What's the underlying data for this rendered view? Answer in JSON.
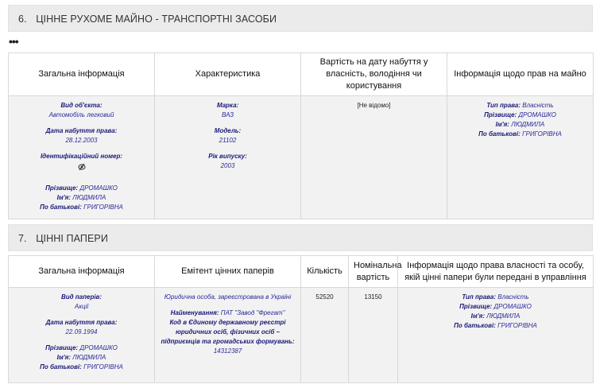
{
  "section6": {
    "number": "6.",
    "title": "ЦІННЕ РУХОМЕ МАЙНО - ТРАНСПОРТНІ ЗАСОБИ",
    "more": "•••",
    "headers": [
      "Загальна інформація",
      "Характеристика",
      "Вартість на дату набуття у власність, володіння чи користування",
      "Інформація щодо прав на майно"
    ],
    "general": {
      "type_label": "Вид об'єкта:",
      "type_value": "Автомобіль легковий",
      "date_label": "Дата набуття права:",
      "date_value": "28.12.2003",
      "id_label": "Ідентифікаційний номер:",
      "id_icon": "hidden-icon",
      "surname_label": "Прізвище:",
      "surname_value": "ДРОМАШКО",
      "name_label": "Ім'я:",
      "name_value": "ЛЮДМИЛА",
      "patronymic_label": "По батькові:",
      "patronymic_value": "ГРИГОРІВНА"
    },
    "specs": {
      "brand_label": "Марка:",
      "brand_value": "ВАЗ",
      "model_label": "Модель:",
      "model_value": "21102",
      "year_label": "Рік випуску:",
      "year_value": "2003"
    },
    "cost": "[Не відомо]",
    "rights": {
      "type_label": "Тип права:",
      "type_value": "Власність",
      "surname_label": "Прізвище:",
      "surname_value": "ДРОМАШКО",
      "name_label": "Ім'я:",
      "name_value": "ЛЮДМИЛА",
      "patronymic_label": "По батькові:",
      "patronymic_value": "ГРИГОРІВНА"
    }
  },
  "section7": {
    "number": "7.",
    "title": "ЦІННІ ПАПЕРИ",
    "headers": [
      "Загальна інформація",
      "Емітент цінних паперів",
      "Кількість",
      "Номінальна вартість",
      "Інформація щодо права власності та особу, якій цінні папери були передані в управління"
    ],
    "general": {
      "type_label": "Вид паперів:",
      "type_value": "Акції",
      "date_label": "Дата набуття права:",
      "date_value": "22.09.1994",
      "surname_label": "Прізвище:",
      "surname_value": "ДРОМАШКО",
      "name_label": "Ім'я:",
      "name_value": "ЛЮДМИЛА",
      "patronymic_label": "По батькові:",
      "patronymic_value": "ГРИГОРІВНА"
    },
    "issuer": {
      "kind": "Юридична особа, зареєстрована в Україні",
      "name_label": "Найменування:",
      "name_value": "ПАТ \"Завод \"Фрегат\"",
      "code_label": "Код в Єдиному державному реєстрі юридичних осіб, фізичних осіб – підприємців та громадських формувань:",
      "code_value": "14312387"
    },
    "quantity": "52520",
    "nominal": "13150",
    "rights": {
      "type_label": "Тип права:",
      "type_value": "Власність",
      "surname_label": "Прізвище:",
      "surname_value": "ДРОМАШКО",
      "name_label": "Ім'я:",
      "name_value": "ЛЮДМИЛА",
      "patronymic_label": "По батькові:",
      "patronymic_value": "ГРИГОРІВНА"
    }
  }
}
